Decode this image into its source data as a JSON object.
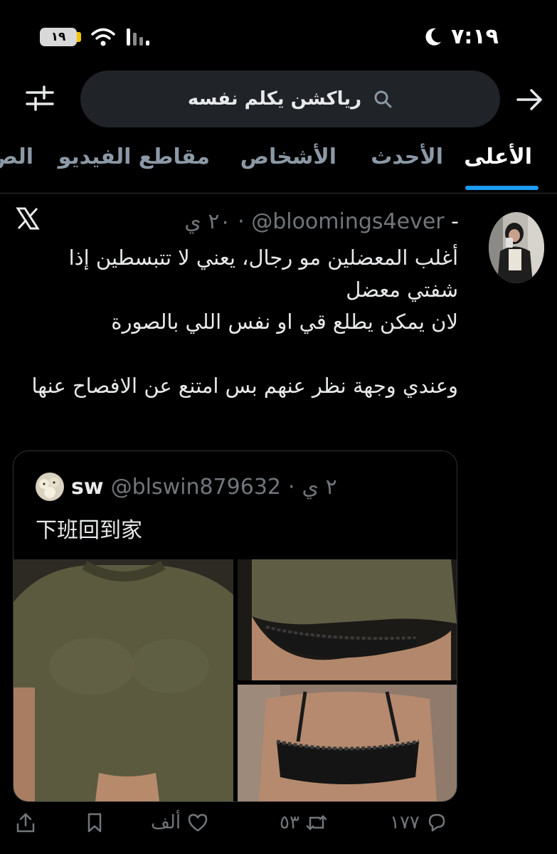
{
  "status_bar": {
    "battery_level": "١٩",
    "battery_fraction": 0.19,
    "time": "٧:١٩",
    "icons": [
      "battery-icon",
      "wifi-icon",
      "signal-icon",
      "moon-icon"
    ]
  },
  "search": {
    "query": "رياكشن يكلم نفسه"
  },
  "tabs": [
    {
      "label": "الأعلى",
      "active": true
    },
    {
      "label": "الأحدث",
      "active": false
    },
    {
      "label": "الأشخاص",
      "active": false
    },
    {
      "label": "مقاطع الفيديو",
      "active": false
    },
    {
      "label": "الص",
      "active": false
    }
  ],
  "tweet": {
    "handle": "bloomings4ever@",
    "time": "٢٠ ي",
    "separator": "·",
    "dash": "-",
    "text_lines": [
      "أغلب المعضلين مو رجال، يعني لا تتبسطين إذا شفتي معضل",
      "لان يمكن يطلع قي او نفس اللي بالصورة",
      "",
      "وعندي وجهة نظر عنهم بس امتنع عن الافصاح عنها"
    ],
    "quote": {
      "name": "sw",
      "handle": "@blswin879632",
      "time": "٢ ي",
      "separator": "·",
      "text": "下班回到家"
    },
    "actions": {
      "replies": "١٧٧",
      "retweets": "٥٣",
      "likes": "ألف"
    }
  },
  "colors": {
    "background": "#000000",
    "accent": "#1d9bf0",
    "muted": "#71767b",
    "search_bg": "#202327",
    "battery_cap": "#f5c400"
  }
}
